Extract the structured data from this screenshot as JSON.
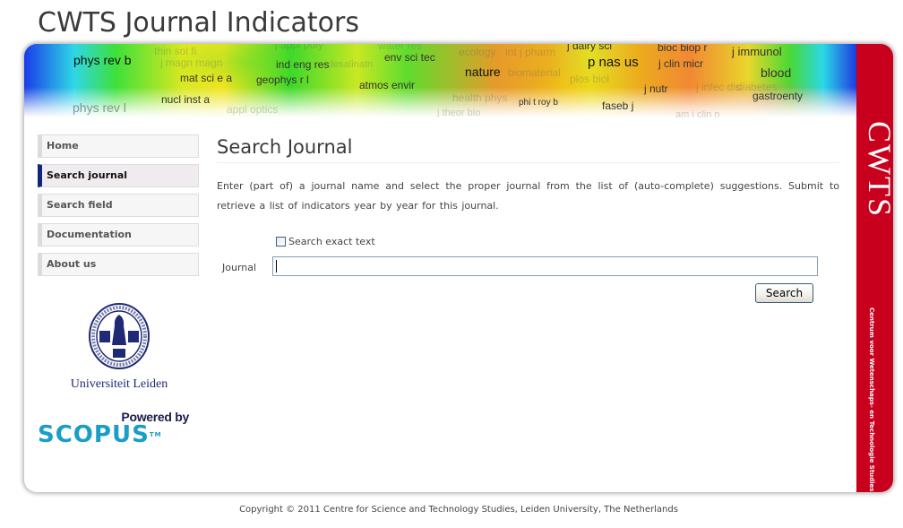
{
  "site": {
    "title": "CWTS Journal Indicators"
  },
  "banner": {
    "words": [
      {
        "text": "phys rev b",
        "weight": "strong"
      },
      {
        "text": "thin sol fi",
        "weight": "faint"
      },
      {
        "text": "j magn magn",
        "weight": "faint"
      },
      {
        "text": "j appl poly",
        "weight": "faint"
      },
      {
        "text": "ind eng res",
        "weight": "mid"
      },
      {
        "text": "water res",
        "weight": "faint"
      },
      {
        "text": "env sci tec",
        "weight": "mid"
      },
      {
        "text": "desalinatn",
        "weight": "faint"
      },
      {
        "text": "ecology",
        "weight": "faint"
      },
      {
        "text": "int j pharm",
        "weight": "faint"
      },
      {
        "text": "j dairy sci",
        "weight": "mid"
      },
      {
        "text": "nature",
        "weight": "strong"
      },
      {
        "text": "biomaterial",
        "weight": "faint"
      },
      {
        "text": "p nas us",
        "weight": "strong"
      },
      {
        "text": "bioc biop r",
        "weight": "mid"
      },
      {
        "text": "j clin micr",
        "weight": "mid"
      },
      {
        "text": "j immunol",
        "weight": "mid"
      },
      {
        "text": "blood",
        "weight": "mid"
      },
      {
        "text": "mat sci e a",
        "weight": "mid"
      },
      {
        "text": "geophys r l",
        "weight": "mid"
      },
      {
        "text": "atmos envir",
        "weight": "mid"
      },
      {
        "text": "plos biol",
        "weight": "faint"
      },
      {
        "text": "j nutr",
        "weight": "mid"
      },
      {
        "text": "j infec dis",
        "weight": "faint"
      },
      {
        "text": "diabetes",
        "weight": "faint"
      },
      {
        "text": "gastroenty",
        "weight": "mid"
      },
      {
        "text": "nucl inst a",
        "weight": "mid"
      },
      {
        "text": "appl optics",
        "weight": "faint"
      },
      {
        "text": "health phys",
        "weight": "faint"
      },
      {
        "text": "phi t roy b",
        "weight": "mid"
      },
      {
        "text": "faseb j",
        "weight": "mid"
      },
      {
        "text": "phys rev l",
        "weight": "faint"
      },
      {
        "text": "j theor bio",
        "weight": "faint"
      },
      {
        "text": "am j clin n",
        "weight": "faint"
      }
    ]
  },
  "brand": {
    "vertical_title": "CWTS",
    "vertical_subtitle": "Centrum voor Wetenschaps- en Technologie Studies",
    "accent_color": "#c8001e"
  },
  "sidebar": {
    "items": [
      {
        "label": "Home",
        "active": false
      },
      {
        "label": "Search journal",
        "active": true
      },
      {
        "label": "Search field",
        "active": false
      },
      {
        "label": "Documentation",
        "active": false
      },
      {
        "label": "About us",
        "active": false
      }
    ],
    "active_color": "#102678"
  },
  "logos": {
    "university": "Universiteit Leiden",
    "powered_by": "Powered by",
    "scopus": "SCOPUS",
    "trademark": "TM"
  },
  "main": {
    "title": "Search Journal",
    "intro": "Enter (part of) a journal name and select the proper journal from the list of (auto-complete) suggestions. Submit to retrieve a list of indicators year by year for this journal.",
    "form": {
      "exact_label": "Search exact text",
      "exact_checked": false,
      "journal_label": "Journal",
      "journal_value": "",
      "search_button": "Search"
    }
  },
  "footer": {
    "copyright": "Copyright © 2011 Centre for Science and Technology Studies, Leiden University, The Netherlands"
  }
}
